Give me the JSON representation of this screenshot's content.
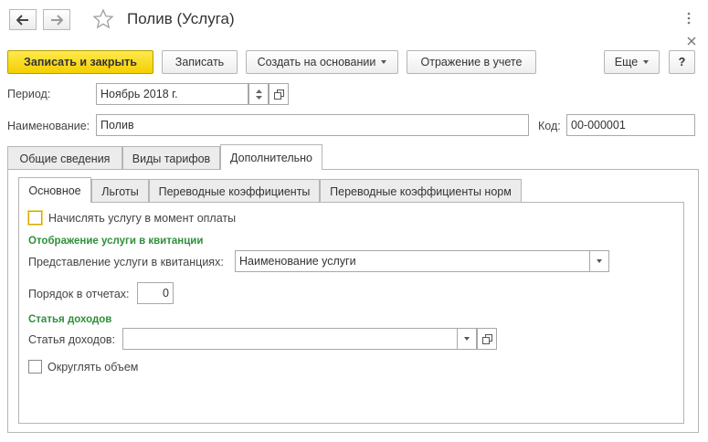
{
  "window": {
    "title": "Полив (Услуга)"
  },
  "toolbar": {
    "save_close": "Записать и закрыть",
    "save": "Записать",
    "create_based": "Создать на основании",
    "accounting": "Отражение в учете",
    "more": "Еще",
    "help": "?"
  },
  "form": {
    "period_label": "Период:",
    "period_value": "Ноябрь 2018 г.",
    "name_label": "Наименование:",
    "name_value": "Полив",
    "code_label": "Код:",
    "code_value": "00-000001"
  },
  "tabs": [
    {
      "label": "Общие сведения"
    },
    {
      "label": "Виды тарифов"
    },
    {
      "label": "Дополнительно"
    }
  ],
  "subtabs": [
    {
      "label": "Основное"
    },
    {
      "label": "Льготы"
    },
    {
      "label": "Переводные коэффициенты"
    },
    {
      "label": "Переводные коэффициенты норм"
    }
  ],
  "main": {
    "charge_on_payment": "Начислять услугу в момент оплаты",
    "receipt_section": "Отображение услуги в квитанции",
    "receipt_repr_label": "Представление услуги в квитанциях:",
    "receipt_repr_value": "Наименование услуги",
    "order_label": "Порядок в отчетах:",
    "order_value": "0",
    "income_section": "Статья доходов",
    "income_label": "Статья доходов:",
    "income_value": "",
    "round_volume": "Округлять объем"
  }
}
